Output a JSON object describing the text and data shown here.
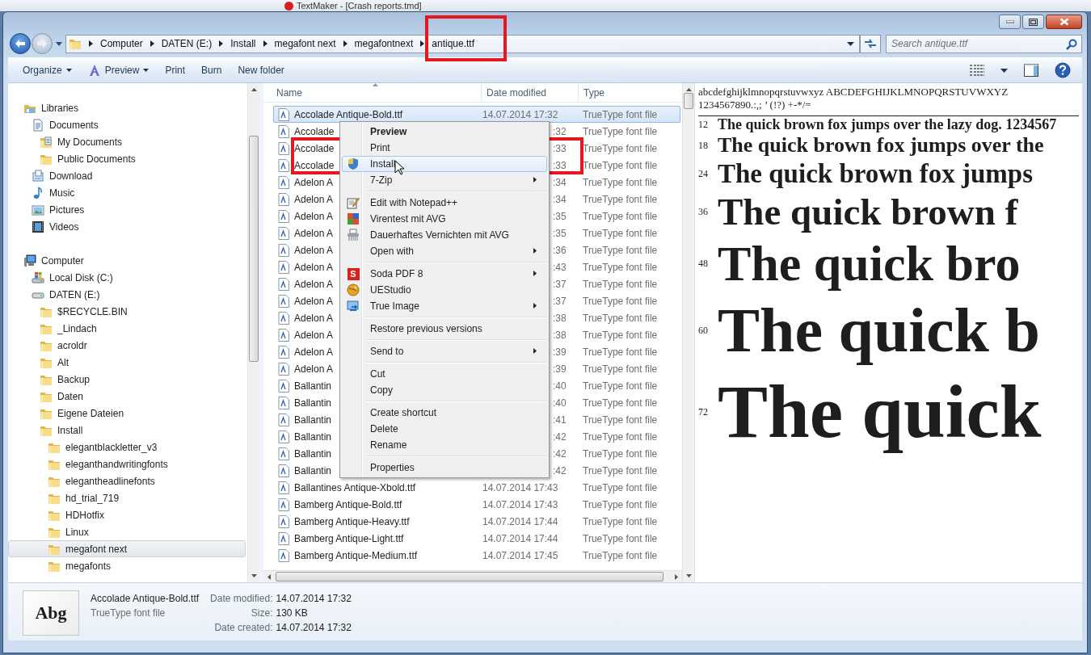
{
  "background_window": {
    "title": "TextMaker - [Crash reports.tmd]"
  },
  "address_bar": {
    "path": [
      "Computer",
      "DATEN (E:)",
      "Install",
      "megafont next",
      "megafontnext",
      "antique.ttf"
    ]
  },
  "search": {
    "placeholder": "Search antique.ttf"
  },
  "toolbar": [
    {
      "label": "Organize",
      "kind": "plain",
      "dropdown": true
    },
    {
      "label": "Preview",
      "kind": "preview",
      "dropdown": true
    },
    {
      "label": "Print",
      "kind": "plain",
      "dropdown": false
    },
    {
      "label": "Burn",
      "kind": "plain",
      "dropdown": false
    },
    {
      "label": "New folder",
      "kind": "plain",
      "dropdown": false
    }
  ],
  "navigation": [
    {
      "label": "Libraries",
      "kind": "library",
      "selected": false,
      "children": [
        {
          "label": "Documents",
          "kind": "documents",
          "selected": false,
          "children": [
            {
              "label": "My Documents",
              "kind": "docfolder",
              "selected": false
            },
            {
              "label": "Public Documents",
              "kind": "folder",
              "selected": false
            }
          ]
        },
        {
          "label": "Download",
          "kind": "download",
          "selected": false
        },
        {
          "label": "Music",
          "kind": "music",
          "selected": false
        },
        {
          "label": "Pictures",
          "kind": "pictures",
          "selected": false
        },
        {
          "label": "Videos",
          "kind": "videos",
          "selected": false
        }
      ]
    },
    {
      "label": "Computer",
      "kind": "computer",
      "selected": false,
      "children": [
        {
          "label": "Local Disk (C:)",
          "kind": "systemdisk",
          "selected": false
        },
        {
          "label": "DATEN (E:)",
          "kind": "drive",
          "selected": false,
          "children": [
            {
              "label": "$RECYCLE.BIN",
              "kind": "folder",
              "selected": false
            },
            {
              "label": "_Lindach",
              "kind": "folder",
              "selected": false
            },
            {
              "label": "acroldr",
              "kind": "folder",
              "selected": false
            },
            {
              "label": "Alt",
              "kind": "folder",
              "selected": false
            },
            {
              "label": "Backup",
              "kind": "folder",
              "selected": false
            },
            {
              "label": "Daten",
              "kind": "folder",
              "selected": false
            },
            {
              "label": "Eigene Dateien",
              "kind": "folder",
              "selected": false
            },
            {
              "label": "Install",
              "kind": "folder",
              "selected": false,
              "children": [
                {
                  "label": "elegantblackletter_v3",
                  "kind": "folder",
                  "selected": false
                },
                {
                  "label": "eleganthandwritingfonts",
                  "kind": "folder",
                  "selected": false
                },
                {
                  "label": "elegantheadlinefonts",
                  "kind": "folder",
                  "selected": false
                },
                {
                  "label": "hd_trial_719",
                  "kind": "folder",
                  "selected": false
                },
                {
                  "label": "HDHotfix",
                  "kind": "folder",
                  "selected": false
                },
                {
                  "label": "Linux",
                  "kind": "folder",
                  "selected": false
                },
                {
                  "label": "megafont next",
                  "kind": "folder",
                  "selected": true
                },
                {
                  "label": "megafonts",
                  "kind": "folder",
                  "selected": false
                }
              ]
            }
          ]
        }
      ]
    }
  ],
  "file_list": {
    "columns": [
      {
        "label": "Name",
        "sorted": true
      },
      {
        "label": "Date modified",
        "sorted": false
      },
      {
        "label": "Type",
        "sorted": false
      }
    ],
    "rows": [
      {
        "name": "Accolade Antique-Bold.ttf",
        "date": "14.07.2014 17:32",
        "type": "TrueType font file",
        "covered": false,
        "selected": true
      },
      {
        "name": "Accolade",
        "date": ":32",
        "type": "TrueType font file",
        "covered": true,
        "selected": false
      },
      {
        "name": "Accolade",
        "date": ":33",
        "type": "TrueType font file",
        "covered": true,
        "selected": false
      },
      {
        "name": "Accolade",
        "date": ":33",
        "type": "TrueType font file",
        "covered": true,
        "selected": false
      },
      {
        "name": "Adelon A",
        "date": ":34",
        "type": "TrueType font file",
        "covered": true,
        "selected": false
      },
      {
        "name": "Adelon A",
        "date": ":34",
        "type": "TrueType font file",
        "covered": true,
        "selected": false
      },
      {
        "name": "Adelon A",
        "date": ":35",
        "type": "TrueType font file",
        "covered": true,
        "selected": false
      },
      {
        "name": "Adelon A",
        "date": ":35",
        "type": "TrueType font file",
        "covered": true,
        "selected": false
      },
      {
        "name": "Adelon A",
        "date": ":36",
        "type": "TrueType font file",
        "covered": true,
        "selected": false
      },
      {
        "name": "Adelon A",
        "date": ":43",
        "type": "TrueType font file",
        "covered": true,
        "selected": false
      },
      {
        "name": "Adelon A",
        "date": ":37",
        "type": "TrueType font file",
        "covered": true,
        "selected": false
      },
      {
        "name": "Adelon A",
        "date": ":37",
        "type": "TrueType font file",
        "covered": true,
        "selected": false
      },
      {
        "name": "Adelon A",
        "date": ":38",
        "type": "TrueType font file",
        "covered": true,
        "selected": false
      },
      {
        "name": "Adelon A",
        "date": ":38",
        "type": "TrueType font file",
        "covered": true,
        "selected": false
      },
      {
        "name": "Adelon A",
        "date": ":39",
        "type": "TrueType font file",
        "covered": true,
        "selected": false
      },
      {
        "name": "Adelon A",
        "date": ":39",
        "type": "TrueType font file",
        "covered": true,
        "selected": false
      },
      {
        "name": "Ballantin",
        "date": ":40",
        "type": "TrueType font file",
        "covered": true,
        "selected": false
      },
      {
        "name": "Ballantin",
        "date": ":40",
        "type": "TrueType font file",
        "covered": true,
        "selected": false
      },
      {
        "name": "Ballantin",
        "date": ":41",
        "type": "TrueType font file",
        "covered": true,
        "selected": false
      },
      {
        "name": "Ballantin",
        "date": ":42",
        "type": "TrueType font file",
        "covered": true,
        "selected": false
      },
      {
        "name": "Ballantin",
        "date": ":42",
        "type": "TrueType font file",
        "covered": true,
        "selected": false
      },
      {
        "name": "Ballantin",
        "date": ":42",
        "type": "TrueType font file",
        "covered": true,
        "selected": false
      },
      {
        "name": "Ballantines Antique-Xbold.ttf",
        "date": "14.07.2014 17:43",
        "type": "TrueType font file",
        "covered": false,
        "selected": false
      },
      {
        "name": "Bamberg Antique-Bold.ttf",
        "date": "14.07.2014 17:43",
        "type": "TrueType font file",
        "covered": false,
        "selected": false
      },
      {
        "name": "Bamberg Antique-Heavy.ttf",
        "date": "14.07.2014 17:44",
        "type": "TrueType font file",
        "covered": false,
        "selected": false
      },
      {
        "name": "Bamberg Antique-Light.ttf",
        "date": "14.07.2014 17:44",
        "type": "TrueType font file",
        "covered": false,
        "selected": false
      },
      {
        "name": "Bamberg Antique-Medium.ttf",
        "date": "14.07.2014 17:45",
        "type": "TrueType font file",
        "covered": false,
        "selected": false
      }
    ]
  },
  "context_menu": [
    {
      "kind": "text",
      "label": "Preview",
      "default": true,
      "submenu": false,
      "selected": false
    },
    {
      "kind": "text",
      "label": "Print",
      "default": false,
      "submenu": false,
      "selected": false
    },
    {
      "kind": "shield",
      "label": "Install",
      "default": false,
      "submenu": false,
      "selected": true
    },
    {
      "kind": "text",
      "label": "7-Zip",
      "default": false,
      "submenu": true,
      "selected": false
    },
    {
      "kind": "separator"
    },
    {
      "kind": "notepad",
      "label": "Edit with Notepad++",
      "default": false,
      "submenu": false,
      "selected": false
    },
    {
      "kind": "avg",
      "label": "Virentest mit AVG",
      "default": false,
      "submenu": false,
      "selected": false
    },
    {
      "kind": "shredder",
      "label": "Dauerhaftes Vernichten mit AVG",
      "default": false,
      "submenu": false,
      "selected": false
    },
    {
      "kind": "text",
      "label": "Open with",
      "default": false,
      "submenu": true,
      "selected": false
    },
    {
      "kind": "separator"
    },
    {
      "kind": "letter",
      "icon_text": "S",
      "label": "Soda PDF 8",
      "default": false,
      "submenu": true,
      "selected": false
    },
    {
      "kind": "globe",
      "label": "UEStudio",
      "default": false,
      "submenu": false,
      "selected": false
    },
    {
      "kind": "backup",
      "label": "True Image",
      "default": false,
      "submenu": true,
      "selected": false
    },
    {
      "kind": "separator"
    },
    {
      "kind": "text",
      "label": "Restore previous versions",
      "default": false,
      "submenu": false,
      "selected": false
    },
    {
      "kind": "separator"
    },
    {
      "kind": "text",
      "label": "Send to",
      "default": false,
      "submenu": true,
      "selected": false
    },
    {
      "kind": "separator"
    },
    {
      "kind": "text",
      "label": "Cut",
      "default": false,
      "submenu": false,
      "selected": false
    },
    {
      "kind": "text",
      "label": "Copy",
      "default": false,
      "submenu": false,
      "selected": false
    },
    {
      "kind": "separator"
    },
    {
      "kind": "text",
      "label": "Create shortcut",
      "default": false,
      "submenu": false,
      "selected": false
    },
    {
      "kind": "text",
      "label": "Delete",
      "default": false,
      "submenu": false,
      "selected": false
    },
    {
      "kind": "text",
      "label": "Rename",
      "default": false,
      "submenu": false,
      "selected": false
    },
    {
      "kind": "separator"
    },
    {
      "kind": "text",
      "label": "Properties",
      "default": false,
      "submenu": false,
      "selected": false
    }
  ],
  "preview": {
    "charset": [
      "abcdefghijklmnopqrstuvwxyz ABCDEFGHIJKLMNOPQRSTUVWXYZ",
      "1234567890.:,; ’ (!?) +-*/="
    ],
    "samples": [
      {
        "size": "12",
        "text": "The quick brown fox jumps over the lazy dog. 1234567"
      },
      {
        "size": "18",
        "text": "The quick brown fox jumps over the"
      },
      {
        "size": "24",
        "text": "The quick brown fox jumps"
      },
      {
        "size": "36",
        "text": "The quick brown f"
      },
      {
        "size": "48",
        "text": "The quick bro"
      },
      {
        "size": "60",
        "text": "The quick b"
      },
      {
        "size": "72",
        "text": "The quick"
      }
    ]
  },
  "details": {
    "thumbnail": "Abg",
    "name": "Accolade Antique-Bold.ttf",
    "type": "TrueType font file",
    "fields": [
      {
        "label": "Date modified:",
        "value": "14.07.2014 17:32"
      },
      {
        "label": "Size:",
        "value": "130 KB"
      },
      {
        "label": "Date created:",
        "value": "14.07.2014 17:32"
      }
    ]
  }
}
